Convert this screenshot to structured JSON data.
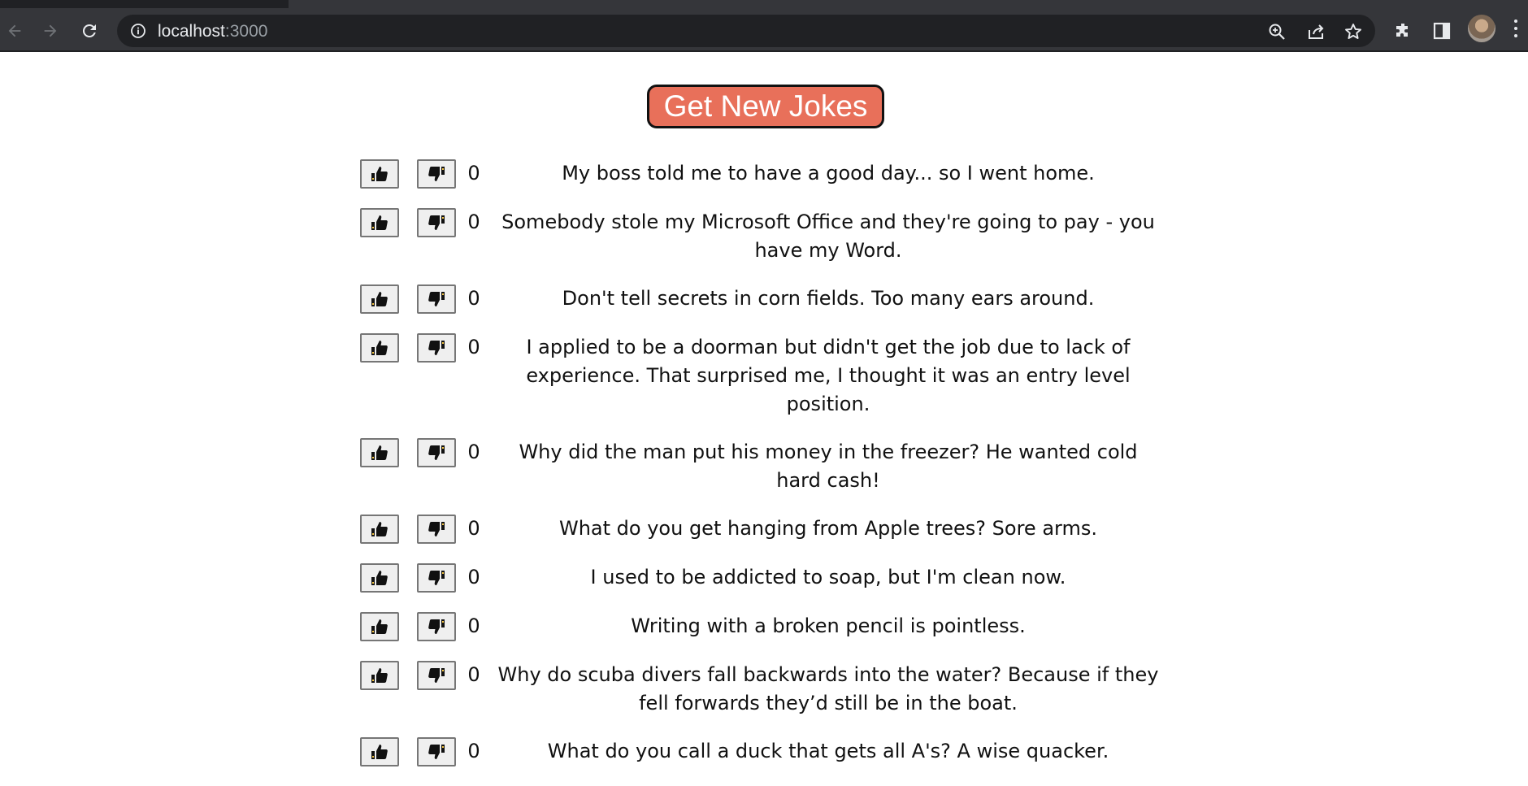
{
  "browser": {
    "url_host": "localhost",
    "url_port": ":3000"
  },
  "main": {
    "get_jokes_label": "Get New Jokes",
    "jokes": [
      {
        "votes": "0",
        "text": "My boss told me to have a good day... so I went home."
      },
      {
        "votes": "0",
        "text": "Somebody stole my Microsoft Office and they're going to pay - you have my Word."
      },
      {
        "votes": "0",
        "text": "Don't tell secrets in corn fields. Too many ears around."
      },
      {
        "votes": "0",
        "text": "I applied to be a doorman but didn't get the job due to lack of experience. That surprised me, I thought it was an entry level position."
      },
      {
        "votes": "0",
        "text": "Why did the man put his money in the freezer? He wanted cold hard cash!"
      },
      {
        "votes": "0",
        "text": "What do you get hanging from Apple trees? Sore arms."
      },
      {
        "votes": "0",
        "text": "I used to be addicted to soap, but I'm clean now."
      },
      {
        "votes": "0",
        "text": "Writing with a broken pencil is pointless."
      },
      {
        "votes": "0",
        "text": "Why do scuba divers fall backwards into the water? Because if they fell forwards they’d still be in the boat."
      },
      {
        "votes": "0",
        "text": "What do you call a duck that gets all A's? A wise quacker."
      }
    ]
  },
  "colors": {
    "button_bg": "#e8705a",
    "chrome_toolbar": "#35363a",
    "omnibox_bg": "#202124"
  },
  "icons": [
    "back-icon",
    "forward-icon",
    "reload-icon",
    "info-icon",
    "zoom-icon",
    "share-icon",
    "star-icon",
    "extensions-icon",
    "side-panel-icon",
    "profile-avatar",
    "menu-icon",
    "thumbs-up-icon",
    "thumbs-down-icon"
  ]
}
